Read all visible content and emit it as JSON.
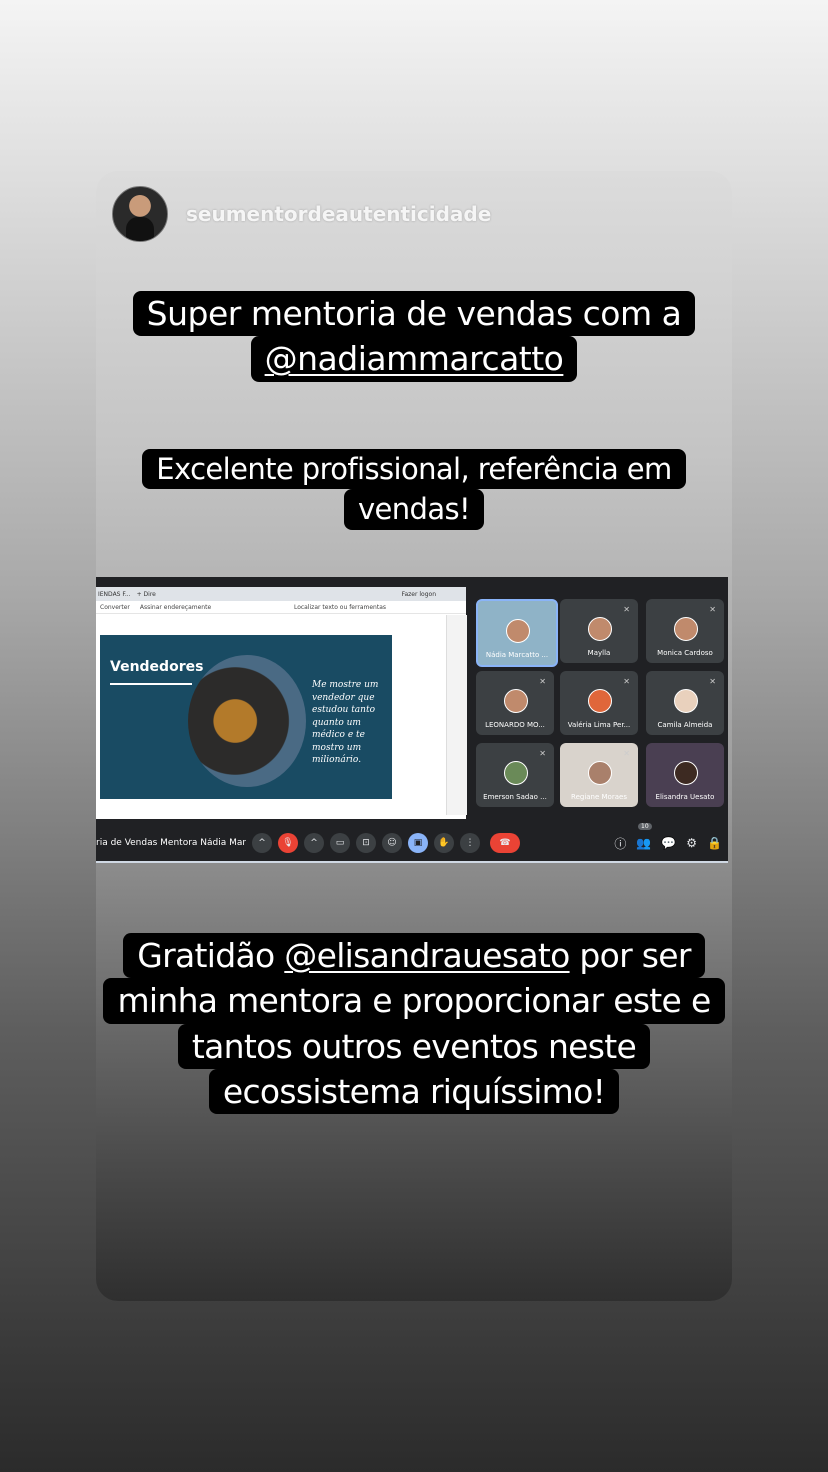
{
  "story": {
    "username": "seumentordeautenticidade",
    "caption1": {
      "line1": "Super mentoria de vendas com a",
      "mention": "@nadiammarcatto"
    },
    "caption2": {
      "line1": "Excelente profissional,  referência em",
      "line2": "vendas!"
    },
    "caption3": {
      "prefix": "Gratidão ",
      "mention": "@elisandrauesato",
      "suffix": " por ser",
      "line2": "minha mentora e proporcionar este e",
      "line3": "tantos outros eventos neste",
      "line4": "ecossistema riquíssimo!"
    }
  },
  "meeting": {
    "browser": {
      "tab": "IENDAS F...",
      "new_tab": "+ Dire",
      "login": "Fazer logon",
      "menu_left": "Converter",
      "menu_mid": "Assinar endereçamente",
      "search": "Localizar texto ou ferramentas"
    },
    "slide": {
      "title": "Vendedores",
      "text": "Me mostre um vendedor que estudou tanto quanto um médico e te mostro um milionário."
    },
    "participants": [
      {
        "name": "Nádia Marcatto ..."
      },
      {
        "name": "Maylla"
      },
      {
        "name": "Monica Cardoso"
      },
      {
        "name": "LEONARDO MO..."
      },
      {
        "name": "Valéria Lima Per..."
      },
      {
        "name": "Camila Almeida"
      },
      {
        "name": "Emerson Sadao ..."
      },
      {
        "name": "Regiane Moraes"
      },
      {
        "name": "Elisandra Uesato"
      }
    ],
    "title": "ria de Vendas Mentora Nádia Marc...",
    "participant_count": "10"
  }
}
